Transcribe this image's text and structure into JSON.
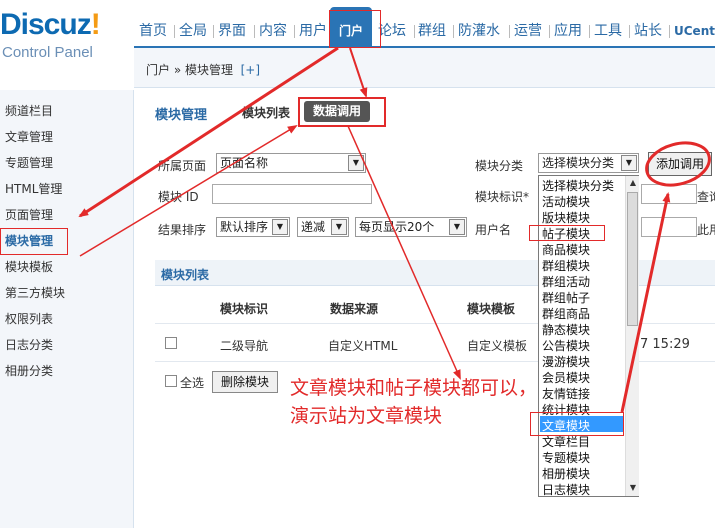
{
  "logo": {
    "brand_main": "Discuz",
    "brand_bang": "!",
    "subtitle": "Control Panel"
  },
  "topnav": {
    "items": [
      "首页",
      "全局",
      "界面",
      "内容",
      "用户",
      "门户",
      "论坛",
      "群组",
      "防灌水",
      "运营",
      "应用",
      "工具",
      "站长",
      "UCenter"
    ],
    "active": "门户"
  },
  "breadcrumb": {
    "path": "门户 » 模块管理",
    "add": "[+]"
  },
  "sidebar": {
    "items": [
      "频道栏目",
      "文章管理",
      "专题管理",
      "HTML管理",
      "页面管理",
      "模块管理",
      "模块模板",
      "第三方模块",
      "权限列表",
      "日志分类",
      "相册分类"
    ],
    "active": "模块管理"
  },
  "main": {
    "title": "模块管理",
    "tab_list": "模块列表",
    "tab_call": "数据调用"
  },
  "filters": {
    "page_label": "所属页面",
    "page_value": "页面名称",
    "category_label": "模块分类",
    "category_value": "选择模块分类",
    "add_button": "添加调用",
    "id_label": "模块 ID",
    "mark_label": "模块标识*",
    "search_cut": "查询",
    "sort_label": "结果排序",
    "sort_value": "默认排序",
    "order_value": "递减",
    "per_page_value": "每页显示20个",
    "user_label": "用户名",
    "right_cut": "此用"
  },
  "list": {
    "header": "模块列表",
    "columns": [
      "模块标识",
      "数据来源",
      "模块模板"
    ],
    "rows": [
      {
        "mark": "二级导航",
        "source": "自定义HTML",
        "template": "自定义模板",
        "time": "7 15:29"
      }
    ],
    "select_all": "全选",
    "delete_button": "删除模块"
  },
  "dropdown": {
    "options": [
      "选择模块分类",
      "活动模块",
      "版块模块",
      "帖子模块",
      "商品模块",
      "群组模块",
      "群组活动",
      "群组帖子",
      "群组商品",
      "静态模块",
      "公告模块",
      "漫游模块",
      "会员模块",
      "友情链接",
      "统计模块",
      "文章模块",
      "文章栏目",
      "专题模块",
      "相册模块",
      "日志模块"
    ],
    "selected": "文章模块"
  },
  "annotation": {
    "text": "文章模块和帖子模块都可以，演示站为文章模块"
  },
  "colors": {
    "accent": "#2a74b5",
    "annotation": "#e22a2a",
    "highlight": "#3399ff",
    "logo_orange": "#f49b14"
  }
}
